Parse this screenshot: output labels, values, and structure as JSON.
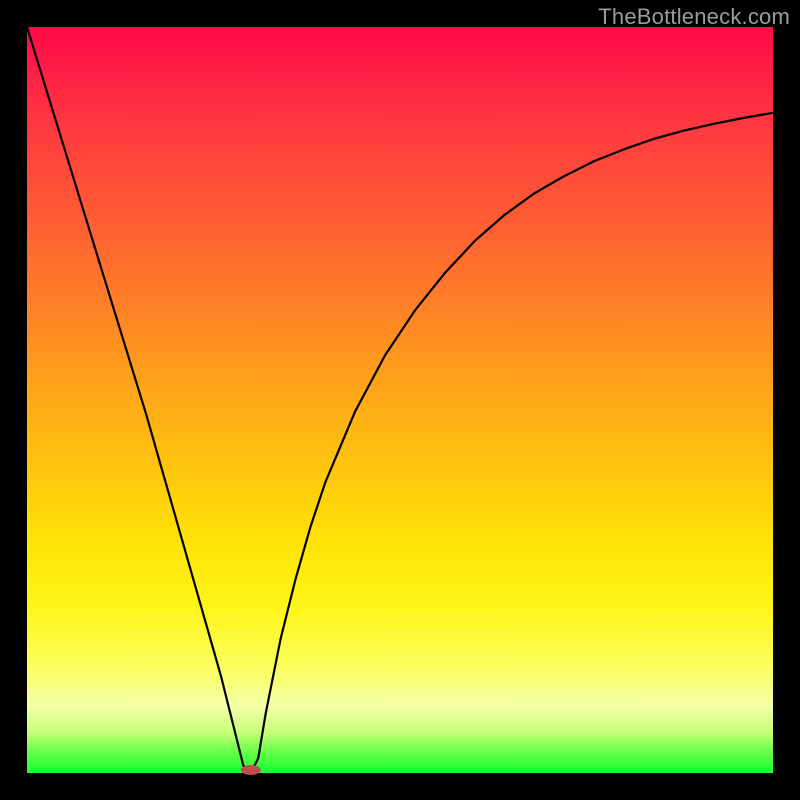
{
  "watermark": {
    "text": "TheBottleneck.com"
  },
  "chart_data": {
    "type": "line",
    "title": "",
    "xlabel": "",
    "ylabel": "",
    "xlim": [
      0,
      100
    ],
    "ylim": [
      0,
      100
    ],
    "x": [
      0,
      2,
      4,
      6,
      8,
      10,
      12,
      14,
      16,
      18,
      20,
      22,
      24,
      26,
      28,
      29,
      30,
      31,
      32,
      34,
      36,
      38,
      40,
      44,
      48,
      52,
      56,
      60,
      64,
      68,
      72,
      76,
      80,
      84,
      88,
      92,
      96,
      100
    ],
    "y": [
      100,
      93.5,
      87,
      80.5,
      74,
      67.5,
      61,
      54.5,
      48,
      41,
      34,
      27,
      20,
      13,
      5,
      1,
      0,
      2,
      8,
      18,
      26,
      33,
      39,
      48.5,
      56,
      62,
      67,
      71.3,
      74.8,
      77.7,
      80.0,
      82.0,
      83.6,
      85.0,
      86.1,
      87.0,
      87.8,
      88.5
    ],
    "marker": {
      "x": 30,
      "y": 0,
      "color": "#c24d4d"
    },
    "background_gradient": {
      "orientation": "vertical",
      "stops": [
        {
          "pos": 0.0,
          "color": "#ff0a4a"
        },
        {
          "pos": 0.25,
          "color": "#ff5a34"
        },
        {
          "pos": 0.5,
          "color": "#ffa31a"
        },
        {
          "pos": 0.78,
          "color": "#fff51a"
        },
        {
          "pos": 0.95,
          "color": "#c8ff7a"
        },
        {
          "pos": 1.0,
          "color": "#15ff33"
        }
      ]
    }
  }
}
